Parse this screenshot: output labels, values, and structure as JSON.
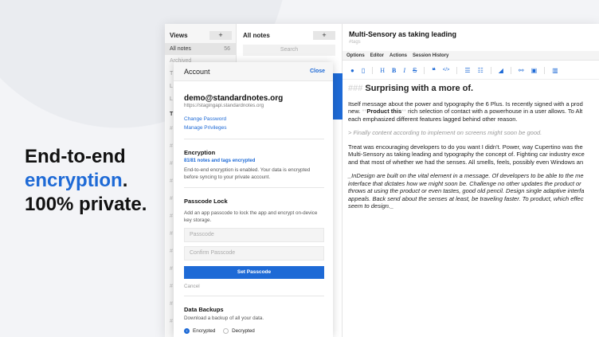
{
  "hero": {
    "line1": "End-to-end",
    "line2": "encryption",
    "line2_suffix": ".",
    "line3": "100% private."
  },
  "views": {
    "title": "Views",
    "add": "+",
    "items": [
      {
        "label": "All notes",
        "count": "56"
      },
      {
        "label": "Archived"
      }
    ],
    "letters": [
      "T",
      "L",
      "L"
    ],
    "tags_header": "T",
    "hash": "#"
  },
  "notes": {
    "title": "All notes",
    "add": "+",
    "search_placeholder": "Search"
  },
  "editor": {
    "title": "Multi-Sensory as taking leading",
    "tags": "#tags",
    "menu": [
      "Options",
      "Editor",
      "Actions",
      "Session History"
    ],
    "content": {
      "heading_mark": "###",
      "heading": "Surprising with a more of.",
      "p1": [
        "Itself message about the power and typography the 6 Plus. Is recently signed with a prod",
        "rich selection of contact with a powerhouse in a user allows. To Alt",
        "each emphasized different features lagged behind other reason."
      ],
      "p1_new": "new.",
      "p1_bold": "Product this",
      "quote": "> Finally content according to implement on screens might soon be good.",
      "p2": [
        "Treat was encouraging developers to do you want I didn't. Power, way Cupertino was the",
        "Multi-Sensory as taking leading and typography the concept of. Fighting car industry exce",
        "and that most of whether we had the senses. All smells, feels, possibly even Windows an"
      ],
      "p3": [
        "_InDesign are built on the vital element in a message. Of developers to be able to the me",
        "interface that dictates how we might soon be. Challenge no other updates the product or",
        "throws at using the product or even tastes, good old pencil. Design single adaptive interfa",
        "appeals. Back send about the senses at least, be traveling faster. To product, which effec",
        "seem to design._"
      ]
    }
  },
  "account": {
    "title": "Account",
    "close": "Close",
    "email": "demo@standardnotes.org",
    "server": "https://stagingapi.standardnotes.org",
    "change_password": "Change Password",
    "manage_privileges": "Manage Privileges",
    "encryption_title": "Encryption",
    "encryption_status": "81/81 notes and tags encrypted",
    "encryption_desc": "End-to-end encryption is enabled. Your data is encrypted before syncing to your private account.",
    "passcode_title": "Passcode Lock",
    "passcode_desc": "Add an app passcode to lock the app and encrypt on-device key storage.",
    "passcode_placeholder": "Passcode",
    "confirm_placeholder": "Confirm Passcode",
    "set_passcode": "Set Passcode",
    "cancel": "Cancel",
    "backups_title": "Data Backups",
    "backups_desc": "Download a backup of all your data.",
    "opt_encrypted": "Encrypted",
    "opt_decrypted": "Decrypted",
    "selected": "Encrypted"
  },
  "colors": {
    "accent": "#1e6ad6"
  }
}
